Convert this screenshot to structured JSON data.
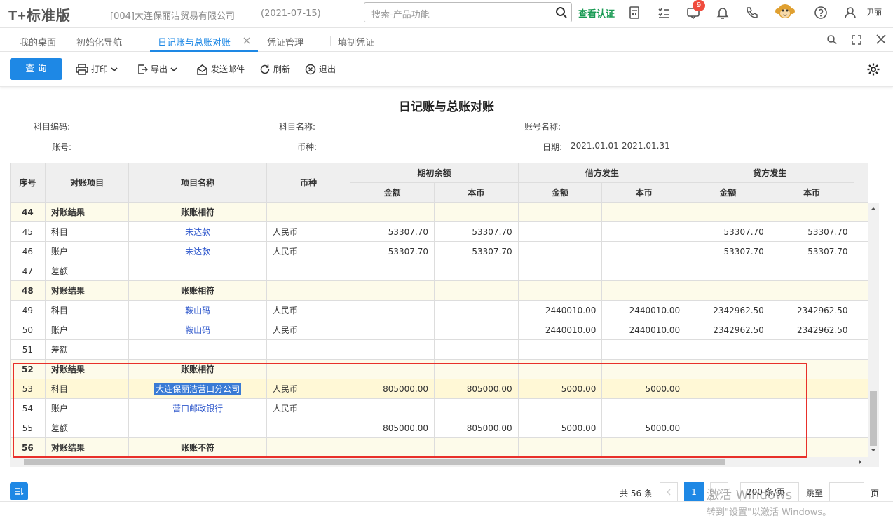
{
  "header": {
    "logo": "T+标准版",
    "company": "[004]大连保丽洁贸易有限公司",
    "date": "(2021-07-15)",
    "search_placeholder": "搜索-产品功能",
    "verify_label": "查看认证",
    "notification_count": "9",
    "user_name": "尹丽"
  },
  "tabs": [
    {
      "label": "我的桌面"
    },
    {
      "label": "初始化导航"
    },
    {
      "label": "日记账与总账对账",
      "active": true
    },
    {
      "label": "凭证管理"
    },
    {
      "label": "填制凭证"
    }
  ],
  "toolbar": {
    "query": "查 询",
    "print": "打印",
    "export": "导出",
    "email": "发送邮件",
    "refresh": "刷新",
    "exit": "退出"
  },
  "report": {
    "title": "日记账与总账对账",
    "subject_code_label": "科目编码:",
    "subject_name_label": "科目名称:",
    "account_name_label": "账号名称:",
    "account_no_label": "账号:",
    "currency_label": "币种:",
    "date_label": "日期:",
    "date_value": "2021.01.01-2021.01.31"
  },
  "table": {
    "headers": {
      "seq": "序号",
      "item": "对账项目",
      "name": "项目名称",
      "currency": "币种",
      "opening": "期初余额",
      "debit": "借方发生",
      "credit": "贷方发生",
      "amount": "金额",
      "base": "本币"
    },
    "rows": [
      {
        "seq": "44",
        "item": "对账结果",
        "name": "账账相符",
        "currency": "",
        "v": [
          "",
          "",
          "",
          "",
          "",
          ""
        ],
        "type": "result"
      },
      {
        "seq": "45",
        "item": "科目",
        "name": "未达款",
        "currency": "人民币",
        "v": [
          "53307.70",
          "53307.70",
          "",
          "",
          "53307.70",
          "53307.70"
        ],
        "type": "link"
      },
      {
        "seq": "46",
        "item": "账户",
        "name": "未达款",
        "currency": "人民币",
        "v": [
          "53307.70",
          "53307.70",
          "",
          "",
          "53307.70",
          "53307.70"
        ],
        "type": "link"
      },
      {
        "seq": "47",
        "item": "差额",
        "name": "",
        "currency": "",
        "v": [
          "",
          "",
          "",
          "",
          "",
          ""
        ],
        "type": "plain"
      },
      {
        "seq": "48",
        "item": "对账结果",
        "name": "账账相符",
        "currency": "",
        "v": [
          "",
          "",
          "",
          "",
          "",
          ""
        ],
        "type": "result"
      },
      {
        "seq": "49",
        "item": "科目",
        "name": "鞍山码",
        "currency": "人民币",
        "v": [
          "",
          "",
          "2440010.00",
          "2440010.00",
          "2342962.50",
          "2342962.50"
        ],
        "type": "link"
      },
      {
        "seq": "50",
        "item": "账户",
        "name": "鞍山码",
        "currency": "人民币",
        "v": [
          "",
          "",
          "2440010.00",
          "2440010.00",
          "2342962.50",
          "2342962.50"
        ],
        "type": "link"
      },
      {
        "seq": "51",
        "item": "差额",
        "name": "",
        "currency": "",
        "v": [
          "",
          "",
          "",
          "",
          "",
          ""
        ],
        "type": "plain"
      },
      {
        "seq": "52",
        "item": "对账结果",
        "name": "账账相符",
        "currency": "",
        "v": [
          "",
          "",
          "",
          "",
          "",
          ""
        ],
        "type": "result"
      },
      {
        "seq": "53",
        "item": "科目",
        "name": "大连保丽洁营口分公司",
        "currency": "人民币",
        "v": [
          "805000.00",
          "805000.00",
          "5000.00",
          "5000.00",
          "",
          ""
        ],
        "type": "selected"
      },
      {
        "seq": "54",
        "item": "账户",
        "name": "营口邮政银行",
        "currency": "人民币",
        "v": [
          "",
          "",
          "",
          "",
          "",
          ""
        ],
        "type": "link"
      },
      {
        "seq": "55",
        "item": "差额",
        "name": "",
        "currency": "",
        "v": [
          "805000.00",
          "805000.00",
          "5000.00",
          "5000.00",
          "",
          ""
        ],
        "type": "plain"
      },
      {
        "seq": "56",
        "item": "对账结果",
        "name": "账账不符",
        "currency": "",
        "v": [
          "",
          "",
          "",
          "",
          "",
          ""
        ],
        "type": "result"
      }
    ]
  },
  "footer": {
    "total": "共 56 条",
    "page": "1",
    "page_size": "200 条/页",
    "jump": "跳至",
    "page_unit": "页"
  },
  "watermark": {
    "line1": "激活 Windows",
    "line2": "转到\"设置\"以激活 Windows。"
  }
}
